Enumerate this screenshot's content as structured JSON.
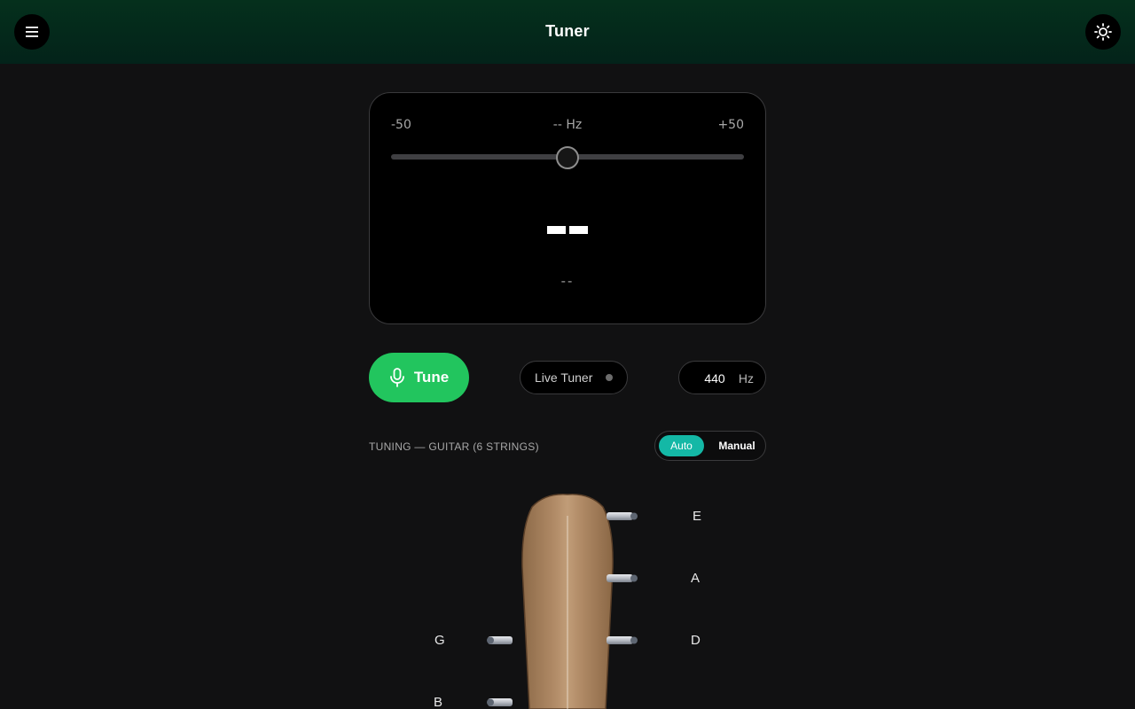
{
  "header": {
    "title": "Tuner",
    "menu_icon": "menu-icon",
    "theme_icon": "sun-icon"
  },
  "meter": {
    "min_label": "-50",
    "max_label": "+50",
    "freq_label": "-- Hz",
    "octave": "--",
    "cents_offset": 0
  },
  "controls": {
    "tune_label": "Tune",
    "live_tuner_label": "Live Tuner",
    "a4_reference": "440",
    "a4_unit": "Hz"
  },
  "tuning": {
    "label": "TUNING — GUITAR (6 STRINGS)",
    "mode_auto": "Auto",
    "mode_manual": "Manual",
    "selected_mode": "Auto",
    "strings_left": [
      "G",
      "B"
    ],
    "strings_right": [
      "E",
      "A",
      "D"
    ]
  },
  "colors": {
    "header_bg": "#03271a",
    "tune_button": "#22c55e",
    "auto_active": "#14b8a6",
    "background": "#111112"
  }
}
